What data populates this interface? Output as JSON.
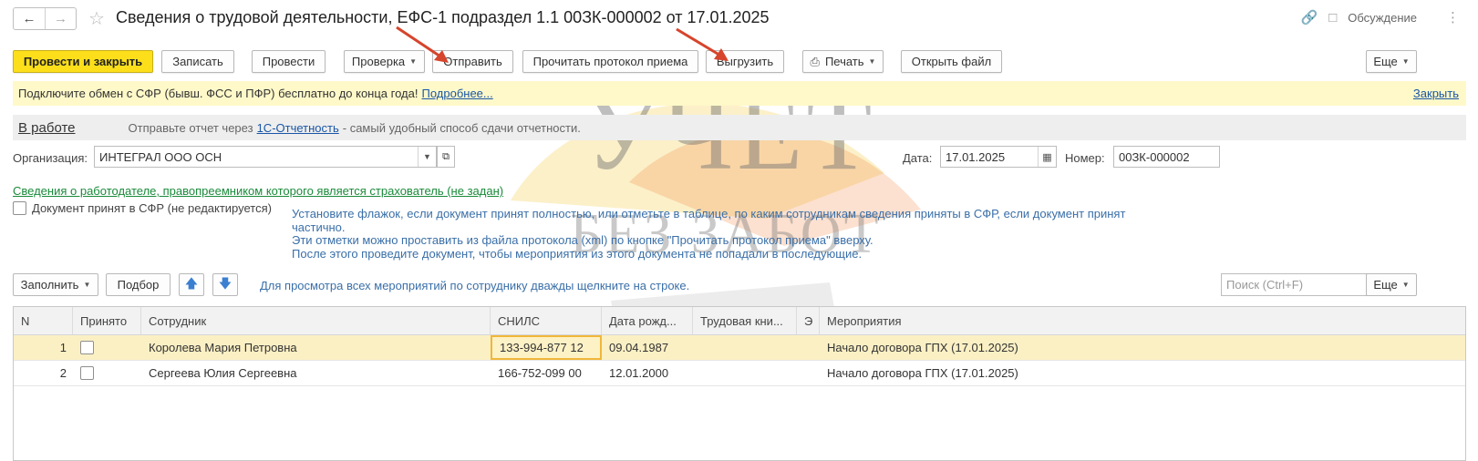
{
  "window": {
    "title": "Сведения о трудовой деятельности, ЕФС-1 подраздел 1.1 00ЗК-000002 от 17.01.2025",
    "discussion_label": "Обсуждение"
  },
  "toolbar": {
    "post_close": "Провести и закрыть",
    "save": "Записать",
    "post": "Провести",
    "check": "Проверка",
    "send": "Отправить",
    "read_protocol": "Прочитать протокол приема",
    "export": "Выгрузить",
    "print": "Печать",
    "open_file": "Открыть файл",
    "more": "Еще"
  },
  "infobar": {
    "text": "Подключите обмен с СФР (бывш. ФСС и ПФР) бесплатно до конца года!",
    "more_link": "Подробнее...",
    "close_link": "Закрыть"
  },
  "status": {
    "state": "В работе",
    "text_before": "Отправьте отчет через",
    "link": "1С-Отчетность",
    "text_after": "- самый удобный способ сдачи отчетности."
  },
  "form": {
    "org_label": "Организация:",
    "org_value": "ИНТЕГРАЛ ООО ОСН",
    "date_label": "Дата:",
    "date_value": "17.01.2025",
    "number_label": "Номер:",
    "number_value": "00ЗК-000002",
    "predecessor_link": "Сведения о работодателе, правопреемником которого является страхователь (не задан)",
    "accepted_checkbox_label": "Документ принят в СФР (не редактируется)",
    "hint_line1": "Установите флажок, если документ принят полностью, или отметьте в таблице, по каким сотрудникам сведения приняты в СФР, если документ принят",
    "hint_line2": "частично.",
    "hint_line3": "Эти отметки можно проставить из файла протокола (xml) по кнопке \"Прочитать протокол приема\" вверху.",
    "hint_line4": "После этого проведите документ, чтобы мероприятия из этого документа не попадали в последующие."
  },
  "table_toolbar": {
    "fill": "Заполнить",
    "pick": "Подбор",
    "hint": "Для просмотра всех мероприятий по сотруднику дважды щелкните на строке.",
    "search_placeholder": "Поиск (Ctrl+F)",
    "more": "Еще"
  },
  "table": {
    "headers": {
      "n": "N",
      "accepted": "Принято",
      "employee": "Сотрудник",
      "snils": "СНИЛС",
      "birth": "Дата рожд...",
      "book": "Трудовая кни...",
      "e": "Э",
      "events": "Мероприятия"
    },
    "rows": [
      {
        "n": "1",
        "employee": "Королева Мария Петровна",
        "snils": "133-994-877 12",
        "birth": "09.04.1987",
        "events": "Начало договора ГПХ (17.01.2025)"
      },
      {
        "n": "2",
        "employee": "Сергеева Юлия Сергеевна",
        "snils": "166-752-099 00",
        "birth": "12.01.2000",
        "events": "Начало договора ГПХ (17.01.2025)"
      }
    ]
  },
  "watermark": {
    "line1": "УЧЕТ",
    "line2": "БЕЗ ЗАБОТ"
  }
}
